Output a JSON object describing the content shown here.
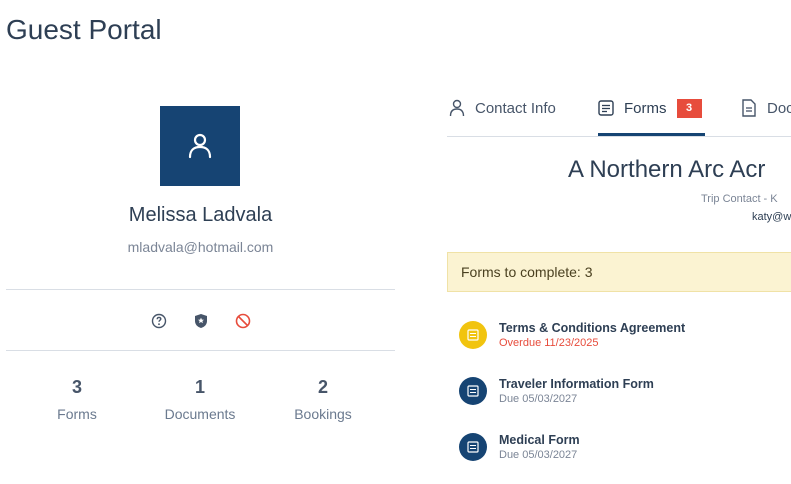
{
  "page": {
    "title": "Guest Portal"
  },
  "profile": {
    "name": "Melissa Ladvala",
    "email": "mladvala@hotmail.com",
    "actions": [
      "help-icon",
      "shield-icon",
      "block-icon"
    ],
    "stats": [
      {
        "value": "3",
        "label": "Forms"
      },
      {
        "value": "1",
        "label": "Documents"
      },
      {
        "value": "2",
        "label": "Bookings"
      }
    ]
  },
  "tabs": [
    {
      "label": "Contact Info",
      "icon": "person-icon"
    },
    {
      "label": "Forms",
      "icon": "form-icon",
      "badge": "3",
      "active": true
    },
    {
      "label": "Doc",
      "icon": "document-icon"
    }
  ],
  "trip": {
    "title": "A Northern Arc Acr",
    "contact": "Trip Contact - K",
    "email": "katy@w"
  },
  "forms": {
    "banner": "Forms to complete: 3",
    "items": [
      {
        "name": "Terms & Conditions Agreement",
        "due": "Overdue 11/23/2025",
        "status": "overdue",
        "icon_color": "#f1c40f"
      },
      {
        "name": "Traveler Information Form",
        "due": "Due 05/03/2027",
        "status": "due",
        "icon_color": "#164473"
      },
      {
        "name": "Medical Form",
        "due": "Due 05/03/2027",
        "status": "due",
        "icon_color": "#164473"
      }
    ]
  },
  "colors": {
    "brand": "#164473",
    "danger": "#e74c3c",
    "warning_bg": "#fbf3d2"
  }
}
